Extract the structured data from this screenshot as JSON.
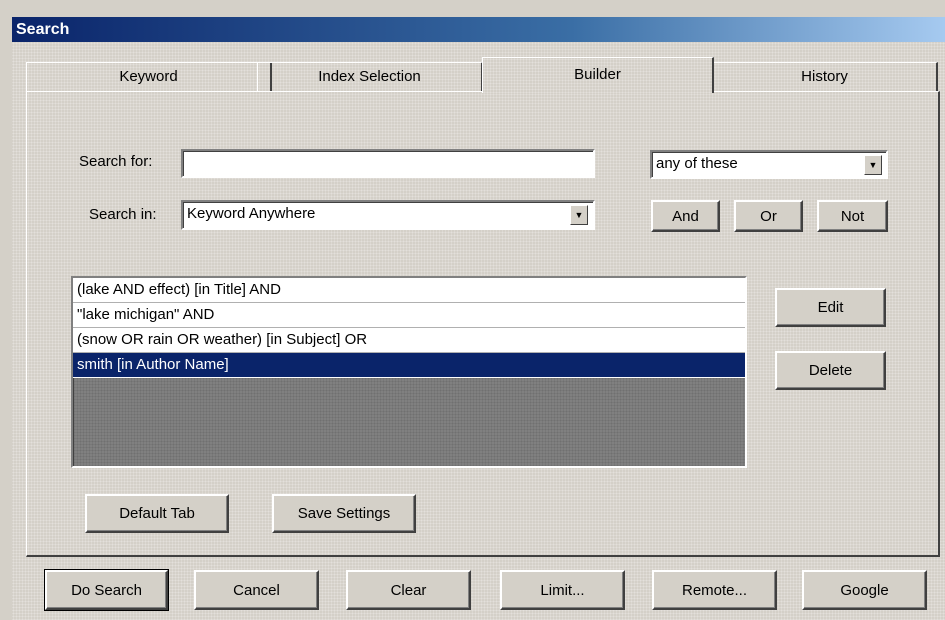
{
  "window": {
    "title": "Search"
  },
  "tabs": [
    {
      "label": "Keyword",
      "active": false
    },
    {
      "label": "Index Selection",
      "active": false
    },
    {
      "label": "Builder",
      "active": true
    },
    {
      "label": "History",
      "active": false
    }
  ],
  "builder": {
    "search_for_label": "Search for:",
    "search_for_value": "",
    "match_select": "any of these",
    "search_in_label": "Search in:",
    "search_in_value": "Keyword Anywhere",
    "and_label": "And",
    "or_label": "Or",
    "not_label": "Not",
    "clauses": [
      "(lake AND effect) [in Title] AND",
      "\"lake michigan\" AND",
      "(snow OR rain OR weather) [in Subject] OR",
      "smith [in Author Name]"
    ],
    "selected_clause_index": 3,
    "edit_label": "Edit",
    "delete_label": "Delete",
    "default_tab_label": "Default Tab",
    "save_settings_label": "Save Settings"
  },
  "footer": {
    "do_search_label": "Do Search",
    "cancel_label": "Cancel",
    "clear_label": "Clear",
    "limit_label": "Limit...",
    "remote_label": "Remote...",
    "google_label": "Google"
  },
  "colors": {
    "title_bar": "#0a246a",
    "selection": "#0a246a",
    "face": "#d4d0c8"
  }
}
